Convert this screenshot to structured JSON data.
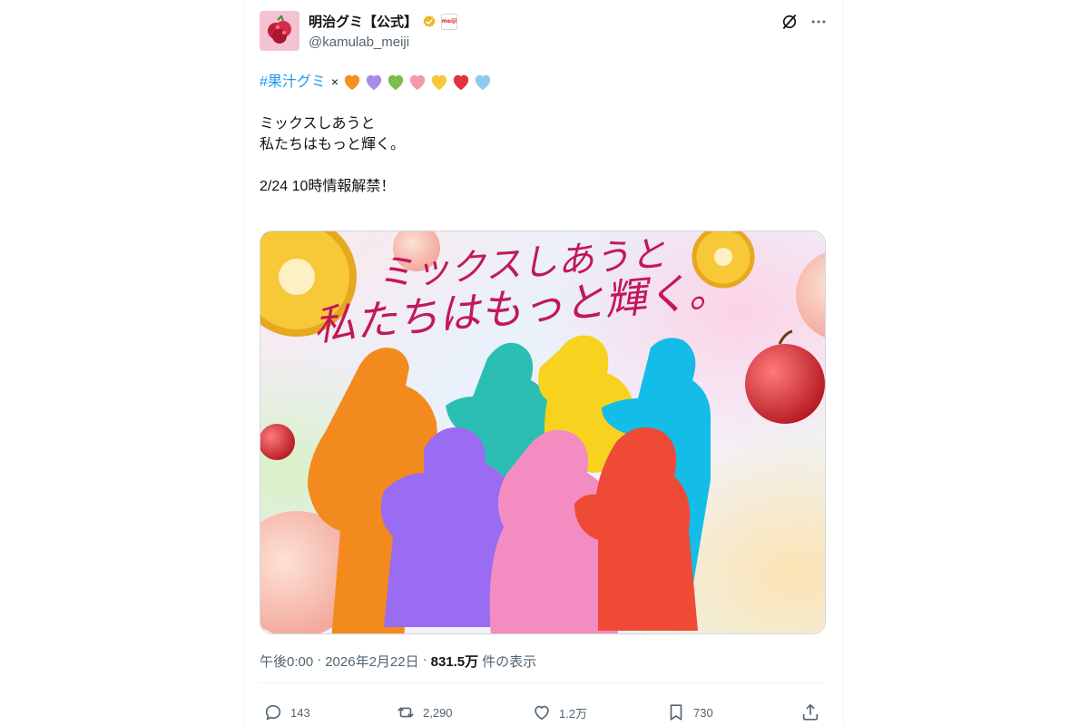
{
  "account": {
    "display_name": "明治グミ【公式】",
    "handle": "@kamulab_meiji",
    "logo_text": "meiji"
  },
  "tweet": {
    "hashtag": "#果汁グミ",
    "times": "×",
    "hearts": [
      "#f4901e",
      "#a98ce6",
      "#7cbd4b",
      "#f39aaa",
      "#f7c83c",
      "#e5303d",
      "#8ec9f2"
    ],
    "line1": "ミックスしあうと",
    "line2": "私たちはもっと輝く。",
    "line3": "2/24 10時情報解禁！"
  },
  "media": {
    "headline_1": "ミックスしあうと",
    "headline_2": "私たちはもっと輝く。"
  },
  "meta": {
    "time": "午後0:00",
    "sep1": "·",
    "date": "2026年2月22日",
    "sep2": "·",
    "views_count": "831.5万",
    "views_label": "件の表示"
  },
  "actions": {
    "reply_count": "143",
    "repost_count": "2,290",
    "like_count": "1.2万",
    "bookmark_count": "730"
  },
  "colors": {
    "accent": "#1d9bf0",
    "verified": "#e8b829",
    "headline": "#c2185b"
  }
}
